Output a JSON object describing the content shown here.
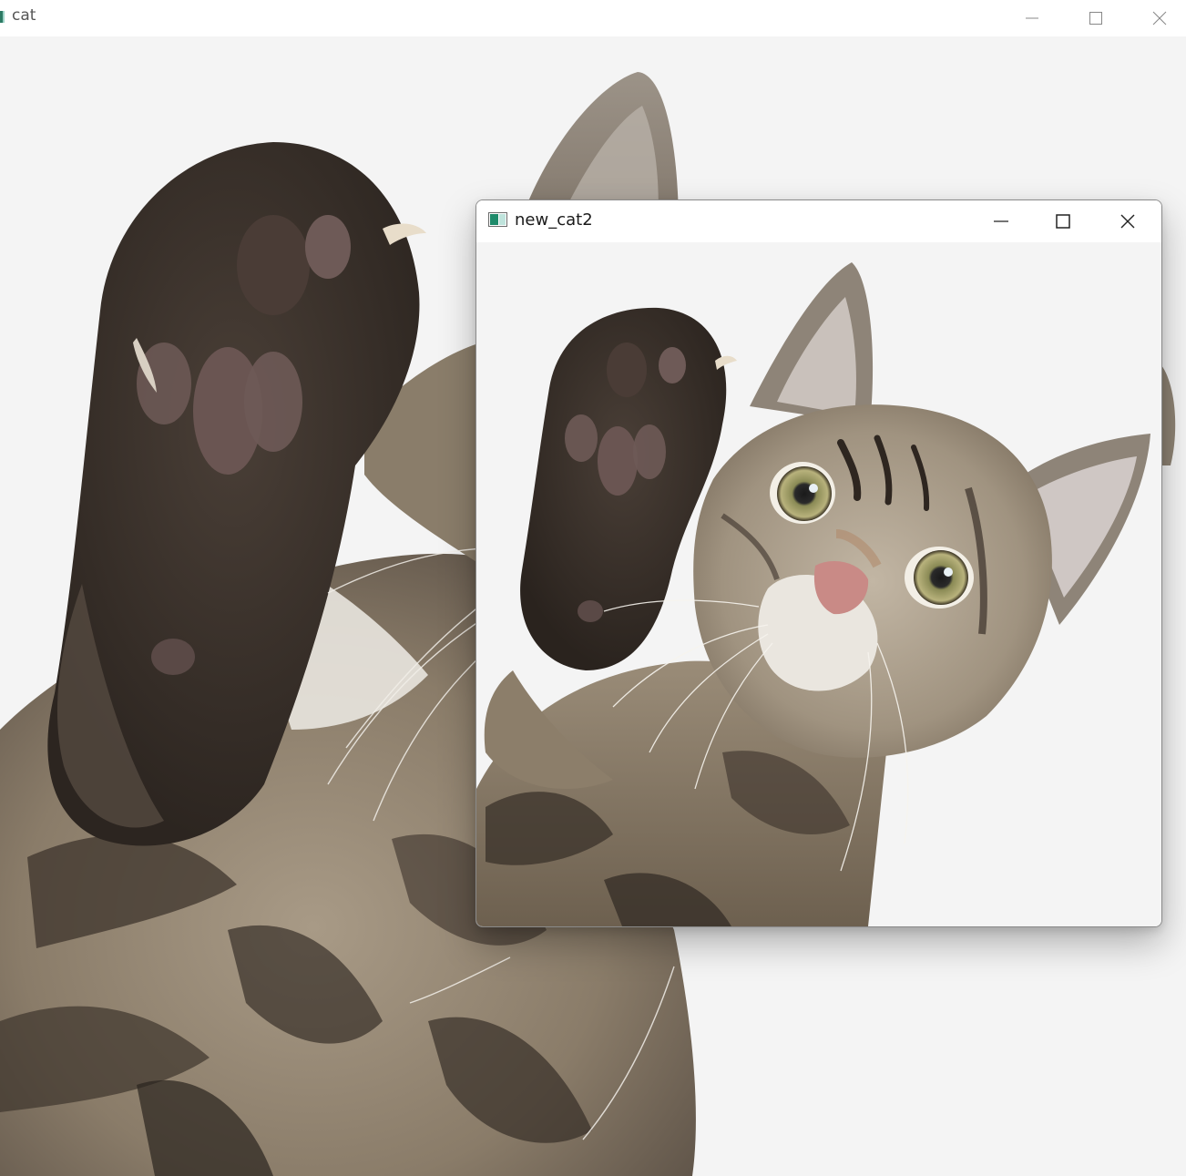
{
  "windows": {
    "back": {
      "title": "cat",
      "controls": [
        "minimize-icon",
        "maximize-icon",
        "close-icon"
      ]
    },
    "front": {
      "title": "new_cat2",
      "controls": [
        "minimize-icon",
        "maximize-icon",
        "close-icon"
      ]
    }
  },
  "colors": {
    "image_background": "#f4f4f4",
    "fur_light": "#b9ac98",
    "fur_mid": "#8d7f6c",
    "fur_dark": "#3a322b",
    "paw_pad": "#6e5a57",
    "eye_iris": "#a9a36a",
    "nose": "#c98a86",
    "titlebar": "#ffffff"
  }
}
